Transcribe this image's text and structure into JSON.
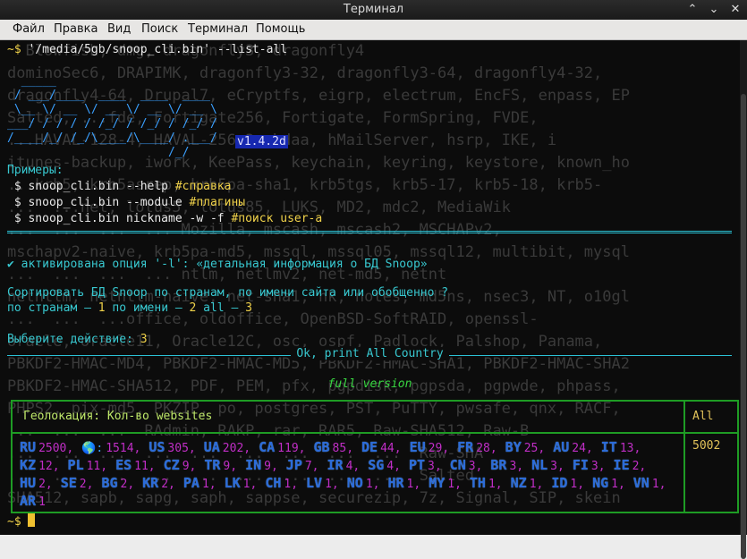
{
  "window": {
    "title": "Терминал",
    "buttons": [
      "⌃",
      "⌄",
      "✕"
    ]
  },
  "menu": [
    "Файл",
    "Правка",
    "Вид",
    "Поиск",
    "Терминал",
    "Помощь"
  ],
  "bg_lines": [
    "  Blowfish, dmg, dragonfly3, dragonfly4",
    "dominoSec6, DRAPIMK, dragonfly3-32, dragonfly3-64, dragonfly4-32,",
    "dragonfly4-64, Drupal7, eCryptfs, eigrp, electrum, EncFS, enpass, EP",
    "Salted, ...fde, Fortigate256, Fortigate, FormSpring, FVDE,",
    "...HAVAL-128-4, HAVAL-256-3, hdaa, hMailServer, hsrp, IKE, i",
    "itunes-backup, iwork, KeePass, keychain, keyring, keystore, known_ho",
    "...krb5, krb5asrep, krb5pa-sha1, krb5tgs, krb5-17, krb5-18, krb5-",
    "...  ...net, lotus5, lotus85, LUKS, MD2, mdc2, MediaWik",
    "...  ...  ...  ... Mozilla, mscash, mscash2, MSCHAPv2,",
    "mschapv2-naive, krb5pa-md5, mssql, mssql05, mssql12, multibit, mysql",
    "...  ...  ...  ... ntlm, netlmv2, net-md5, netnt",
    "netntlm, netntlm-naive, net-sha1, nk, notes, md5ns, nsec3, NT, o10gl",
    "...  ...  ...office, oldoffice, OpenBSD-SoftRAID, openssl-",
    "oracle, oracle11, Oracle12C, osc, ospf, Padlock, Palshop, Panama,",
    "PBKDF2-HMAC-MD4, PBKDF2-HMAC-MD5, PBKDF2-HMAC-SHA1, PBKDF2-HMAC-SHA2",
    "PBKDF2-HMAC-SHA512, PDF, PEM, pfx, pgpdisk, pgpsda, pgpwde, phpass,",
    "PHPS2, pix-md5, PKZIP, po, postgres, PST, PuTTY, pwsafe, qnx, RACF,",
    "...  ...  ...  RAdmin, RAKP, rar, RAR5, Raw-SHA512, Raw-B",
    "...  ...  ...  ...  ...  ...  ...  ...  ...  Raw-SHA",
    "...  ...  ...  ...  ...  ...  ...  ...  ...  Salted",
    "SHA512, sapb, sapg, saph, sappse, securezip, 7z, Signal, SIP, skein"
  ],
  "cmd": {
    "prompt": "~$",
    "text": " '/media/5gb/snoop_cli.bin' --list-all"
  },
  "ascii_logo": [
    "  _____",
    " / ___/____  ____  ____  ____",
    " \\__ \\/ __ \\/ __ \\/ __ \\/ __ \\",
    "___/ / / / / /_/ / /_/ / /_/ /",
    "/____/_/ /_/\\____/\\____/ .___/",
    "                       /_/"
  ],
  "version": "v1.4.2d",
  "examples": {
    "header": "Примеры:",
    "lines": [
      {
        "cmd": " $ snoop_cli.bin --help ",
        "comment": "#справка"
      },
      {
        "cmd": " $ snoop_cli.bin --module ",
        "comment": "#плагины"
      },
      {
        "cmd": " $ snoop_cli.bin nickname -w -f ",
        "comment": "#поиск user-a"
      }
    ]
  },
  "option_msg": "✔ активирована опция '-l': «детальная информация о БД Snoop»",
  "sort_q": "Сортировать БД Snoop по странам, по имени сайта или обобщенно ?",
  "sort_opts": {
    "a": "по странам — ",
    "n1": "1",
    "b": " по имени — ",
    "n2": "2",
    "c": " all — ",
    "n3": "3"
  },
  "choice": {
    "label": "Выберите действие: ",
    "value": "3"
  },
  "ok_msg": "Ok, print All Country",
  "full_version": "full version",
  "table": {
    "header_left": "Геолокация: Кол-во websites",
    "header_right": "All",
    "total": "5002",
    "countries": [
      {
        "code": "RU",
        "count": "2500,"
      },
      {
        "code": "🌎:",
        "count": "1514,"
      },
      {
        "code": "US",
        "count": "305,"
      },
      {
        "code": "UA",
        "count": "202,"
      },
      {
        "code": "CA",
        "count": "119,"
      },
      {
        "code": "GB",
        "count": "85,"
      },
      {
        "code": "DE",
        "count": "44,"
      },
      {
        "code": "EU",
        "count": "29,"
      },
      {
        "code": "FR",
        "count": "28,"
      },
      {
        "code": "BY",
        "count": "25,"
      },
      {
        "code": "AU",
        "count": "24,"
      },
      {
        "code": "IT",
        "count": "13,"
      },
      {
        "code": "KZ",
        "count": "12,"
      },
      {
        "code": "PL",
        "count": "11,"
      },
      {
        "code": "ES",
        "count": "11,"
      },
      {
        "code": "CZ",
        "count": "9,"
      },
      {
        "code": "TR",
        "count": "9,"
      },
      {
        "code": "IN",
        "count": "9,"
      },
      {
        "code": "JP",
        "count": "7,"
      },
      {
        "code": "IR",
        "count": "4,"
      },
      {
        "code": "SG",
        "count": "4,"
      },
      {
        "code": "PT",
        "count": "3,"
      },
      {
        "code": "CN",
        "count": "3,"
      },
      {
        "code": "BR",
        "count": "3,"
      },
      {
        "code": "NL",
        "count": "3,"
      },
      {
        "code": "FI",
        "count": "3,"
      },
      {
        "code": "IE",
        "count": "2,"
      },
      {
        "code": "HU",
        "count": "2,"
      },
      {
        "code": "SE",
        "count": "2,"
      },
      {
        "code": "BG",
        "count": "2,"
      },
      {
        "code": "KR",
        "count": "2,"
      },
      {
        "code": "PA",
        "count": "1,"
      },
      {
        "code": "LK",
        "count": "1,"
      },
      {
        "code": "CH",
        "count": "1,"
      },
      {
        "code": "LV",
        "count": "1,"
      },
      {
        "code": "NO",
        "count": "1,"
      },
      {
        "code": "HR",
        "count": "1,"
      },
      {
        "code": "MY",
        "count": "1,"
      },
      {
        "code": "TH",
        "count": "1,"
      },
      {
        "code": "NZ",
        "count": "1,"
      },
      {
        "code": "ID",
        "count": "1,"
      },
      {
        "code": "NG",
        "count": "1,"
      },
      {
        "code": "VN",
        "count": "1,"
      },
      {
        "code": "AR",
        "count": "1"
      }
    ]
  },
  "final_prompt": "~$ "
}
